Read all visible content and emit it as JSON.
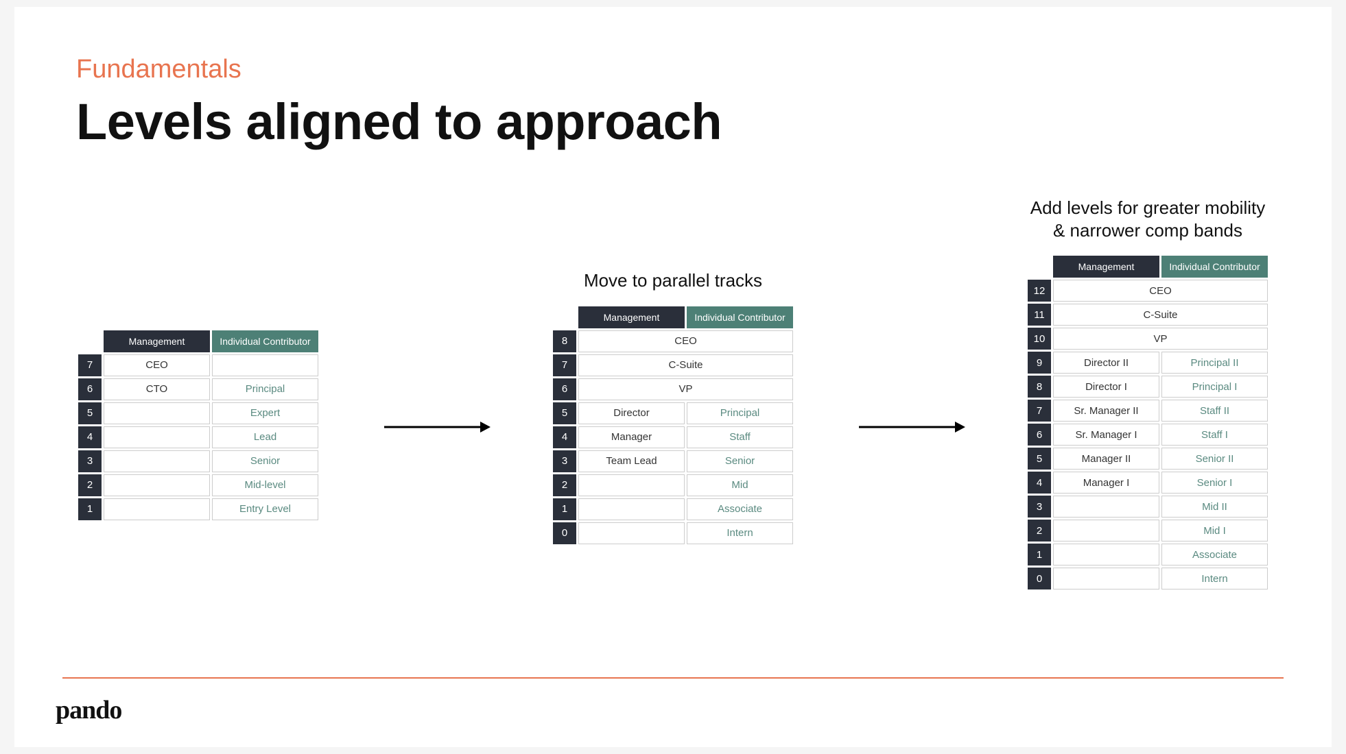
{
  "eyebrow": "Fundamentals",
  "title": "Levels aligned to approach",
  "headers": {
    "management": "Management",
    "individual_contributor": "Individual Contributor"
  },
  "captions": {
    "parallel": "Move to parallel tracks",
    "expanded": "Add levels for greater mobility\n& narrower comp bands"
  },
  "tables": {
    "simple": [
      {
        "level": "7",
        "mgmt": "CEO",
        "ic": ""
      },
      {
        "level": "6",
        "mgmt": "CTO",
        "ic": "Principal"
      },
      {
        "level": "5",
        "mgmt": "",
        "ic": "Expert"
      },
      {
        "level": "4",
        "mgmt": "",
        "ic": "Lead"
      },
      {
        "level": "3",
        "mgmt": "",
        "ic": "Senior"
      },
      {
        "level": "2",
        "mgmt": "",
        "ic": "Mid-level"
      },
      {
        "level": "1",
        "mgmt": "",
        "ic": "Entry Level"
      }
    ],
    "parallel": [
      {
        "level": "8",
        "merged": "CEO"
      },
      {
        "level": "7",
        "merged": "C-Suite"
      },
      {
        "level": "6",
        "merged": "VP"
      },
      {
        "level": "5",
        "mgmt": "Director",
        "ic": "Principal"
      },
      {
        "level": "4",
        "mgmt": "Manager",
        "ic": "Staff"
      },
      {
        "level": "3",
        "mgmt": "Team Lead",
        "ic": "Senior"
      },
      {
        "level": "2",
        "mgmt": "",
        "ic": "Mid"
      },
      {
        "level": "1",
        "mgmt": "",
        "ic": "Associate"
      },
      {
        "level": "0",
        "mgmt": "",
        "ic": "Intern"
      }
    ],
    "expanded": [
      {
        "level": "12",
        "merged": "CEO"
      },
      {
        "level": "11",
        "merged": "C-Suite"
      },
      {
        "level": "10",
        "merged": "VP"
      },
      {
        "level": "9",
        "mgmt": "Director II",
        "ic": "Principal II"
      },
      {
        "level": "8",
        "mgmt": "Director I",
        "ic": "Principal I"
      },
      {
        "level": "7",
        "mgmt": "Sr. Manager II",
        "ic": "Staff II"
      },
      {
        "level": "6",
        "mgmt": "Sr. Manager I",
        "ic": "Staff I"
      },
      {
        "level": "5",
        "mgmt": "Manager II",
        "ic": "Senior II"
      },
      {
        "level": "4",
        "mgmt": "Manager I",
        "ic": "Senior I"
      },
      {
        "level": "3",
        "mgmt": "",
        "ic": "Mid II"
      },
      {
        "level": "2",
        "mgmt": "",
        "ic": "Mid I"
      },
      {
        "level": "1",
        "mgmt": "",
        "ic": "Associate"
      },
      {
        "level": "0",
        "mgmt": "",
        "ic": "Intern"
      }
    ]
  },
  "logo": "pando"
}
